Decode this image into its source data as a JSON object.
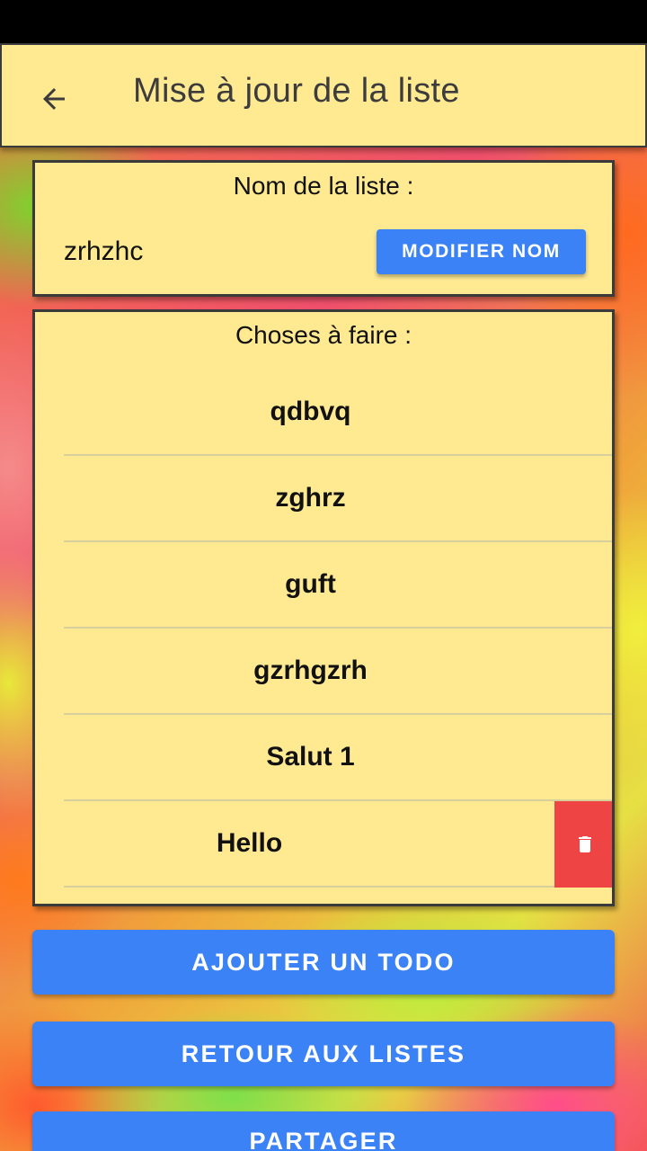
{
  "app_bar": {
    "title": "Mise à jour de la liste",
    "back_icon": "arrow-left-icon"
  },
  "name_card": {
    "title": "Nom de la liste :",
    "list_name": "zrhzhc",
    "modify_button": "MODIFIER NOM"
  },
  "todos_card": {
    "title": "Choses à faire :",
    "items": [
      {
        "label": "qdbvq"
      },
      {
        "label": "zghrz"
      },
      {
        "label": "guft"
      },
      {
        "label": "gzrhgzrh"
      },
      {
        "label": "Salut 1"
      },
      {
        "label": "Hello"
      }
    ],
    "delete_icon": "trash-icon"
  },
  "actions": {
    "add_todo": "AJOUTER UN TODO",
    "back_to_lists": "RETOUR AUX LISTES",
    "share": "PARTAGER"
  },
  "colors": {
    "card_bg": "#ffe991",
    "button_blue": "#3b82f6",
    "delete_red": "#ef4444",
    "border": "#3a3a3a"
  }
}
